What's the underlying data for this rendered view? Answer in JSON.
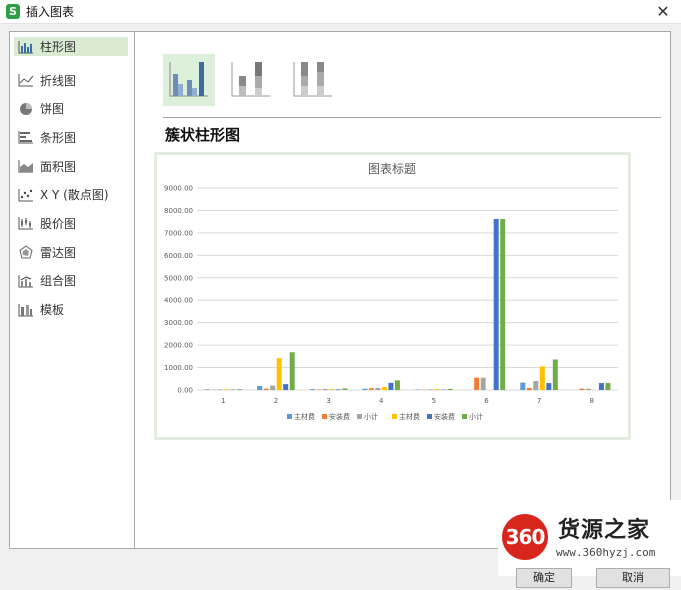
{
  "window": {
    "title": "插入图表",
    "app_icon_letter": "S"
  },
  "sidebar": {
    "items": [
      {
        "label": "柱形图",
        "icon": "column-chart-icon",
        "active": true
      },
      {
        "label": "折线图",
        "icon": "line-chart-icon"
      },
      {
        "label": "饼图",
        "icon": "pie-chart-icon"
      },
      {
        "label": "条形图",
        "icon": "bar-chart-icon"
      },
      {
        "label": "面积图",
        "icon": "area-chart-icon"
      },
      {
        "label": "X Y (散点图)",
        "icon": "scatter-chart-icon"
      },
      {
        "label": "股价图",
        "icon": "stock-chart-icon"
      },
      {
        "label": "雷达图",
        "icon": "radar-chart-icon"
      },
      {
        "label": "组合图",
        "icon": "combo-chart-icon"
      },
      {
        "label": "模板",
        "icon": "template-icon"
      }
    ]
  },
  "subtypes": [
    {
      "icon": "clustered-column-icon",
      "selected": true
    },
    {
      "icon": "stacked-column-icon",
      "selected": false
    },
    {
      "icon": "percent-stacked-column-icon",
      "selected": false
    }
  ],
  "preview_heading": "簇状柱形图",
  "chart_data": {
    "type": "bar",
    "title": "图表标题",
    "categories": [
      "1",
      "2",
      "3",
      "4",
      "5",
      "6",
      "7",
      "8"
    ],
    "ylim": [
      0,
      9000
    ],
    "yticks": [
      "0.00",
      "1000.00",
      "2000.00",
      "3000.00",
      "4000.00",
      "5000.00",
      "6000.00",
      "7000.00",
      "8000.00",
      "9000.00"
    ],
    "grid": true,
    "legend_position": "bottom",
    "series": [
      {
        "name": "主材费",
        "color": "#5b9bd5",
        "values": [
          30,
          180,
          40,
          60,
          20,
          0,
          330,
          0
        ]
      },
      {
        "name": "安装费",
        "color": "#ed7d31",
        "values": [
          15,
          60,
          25,
          80,
          15,
          550,
          90,
          60
        ]
      },
      {
        "name": "小计",
        "color": "#a5a5a5",
        "values": [
          30,
          200,
          50,
          90,
          30,
          550,
          400,
          60
        ]
      },
      {
        "name": "主材费",
        "color": "#ffc000",
        "values": [
          30,
          1420,
          40,
          130,
          40,
          0,
          1050,
          0
        ]
      },
      {
        "name": "安装费",
        "color": "#4472c4",
        "values": [
          20,
          260,
          30,
          320,
          20,
          7620,
          310,
          310
        ]
      },
      {
        "name": "小计",
        "color": "#70ad47",
        "values": [
          35,
          1680,
          70,
          430,
          50,
          7620,
          1360,
          310
        ]
      }
    ]
  },
  "watermark": {
    "logo_text": "360",
    "name": "货源之家",
    "url": "www.360hyzj.com"
  },
  "footer": {
    "ok_label": "确定",
    "cancel_label": "取消"
  }
}
